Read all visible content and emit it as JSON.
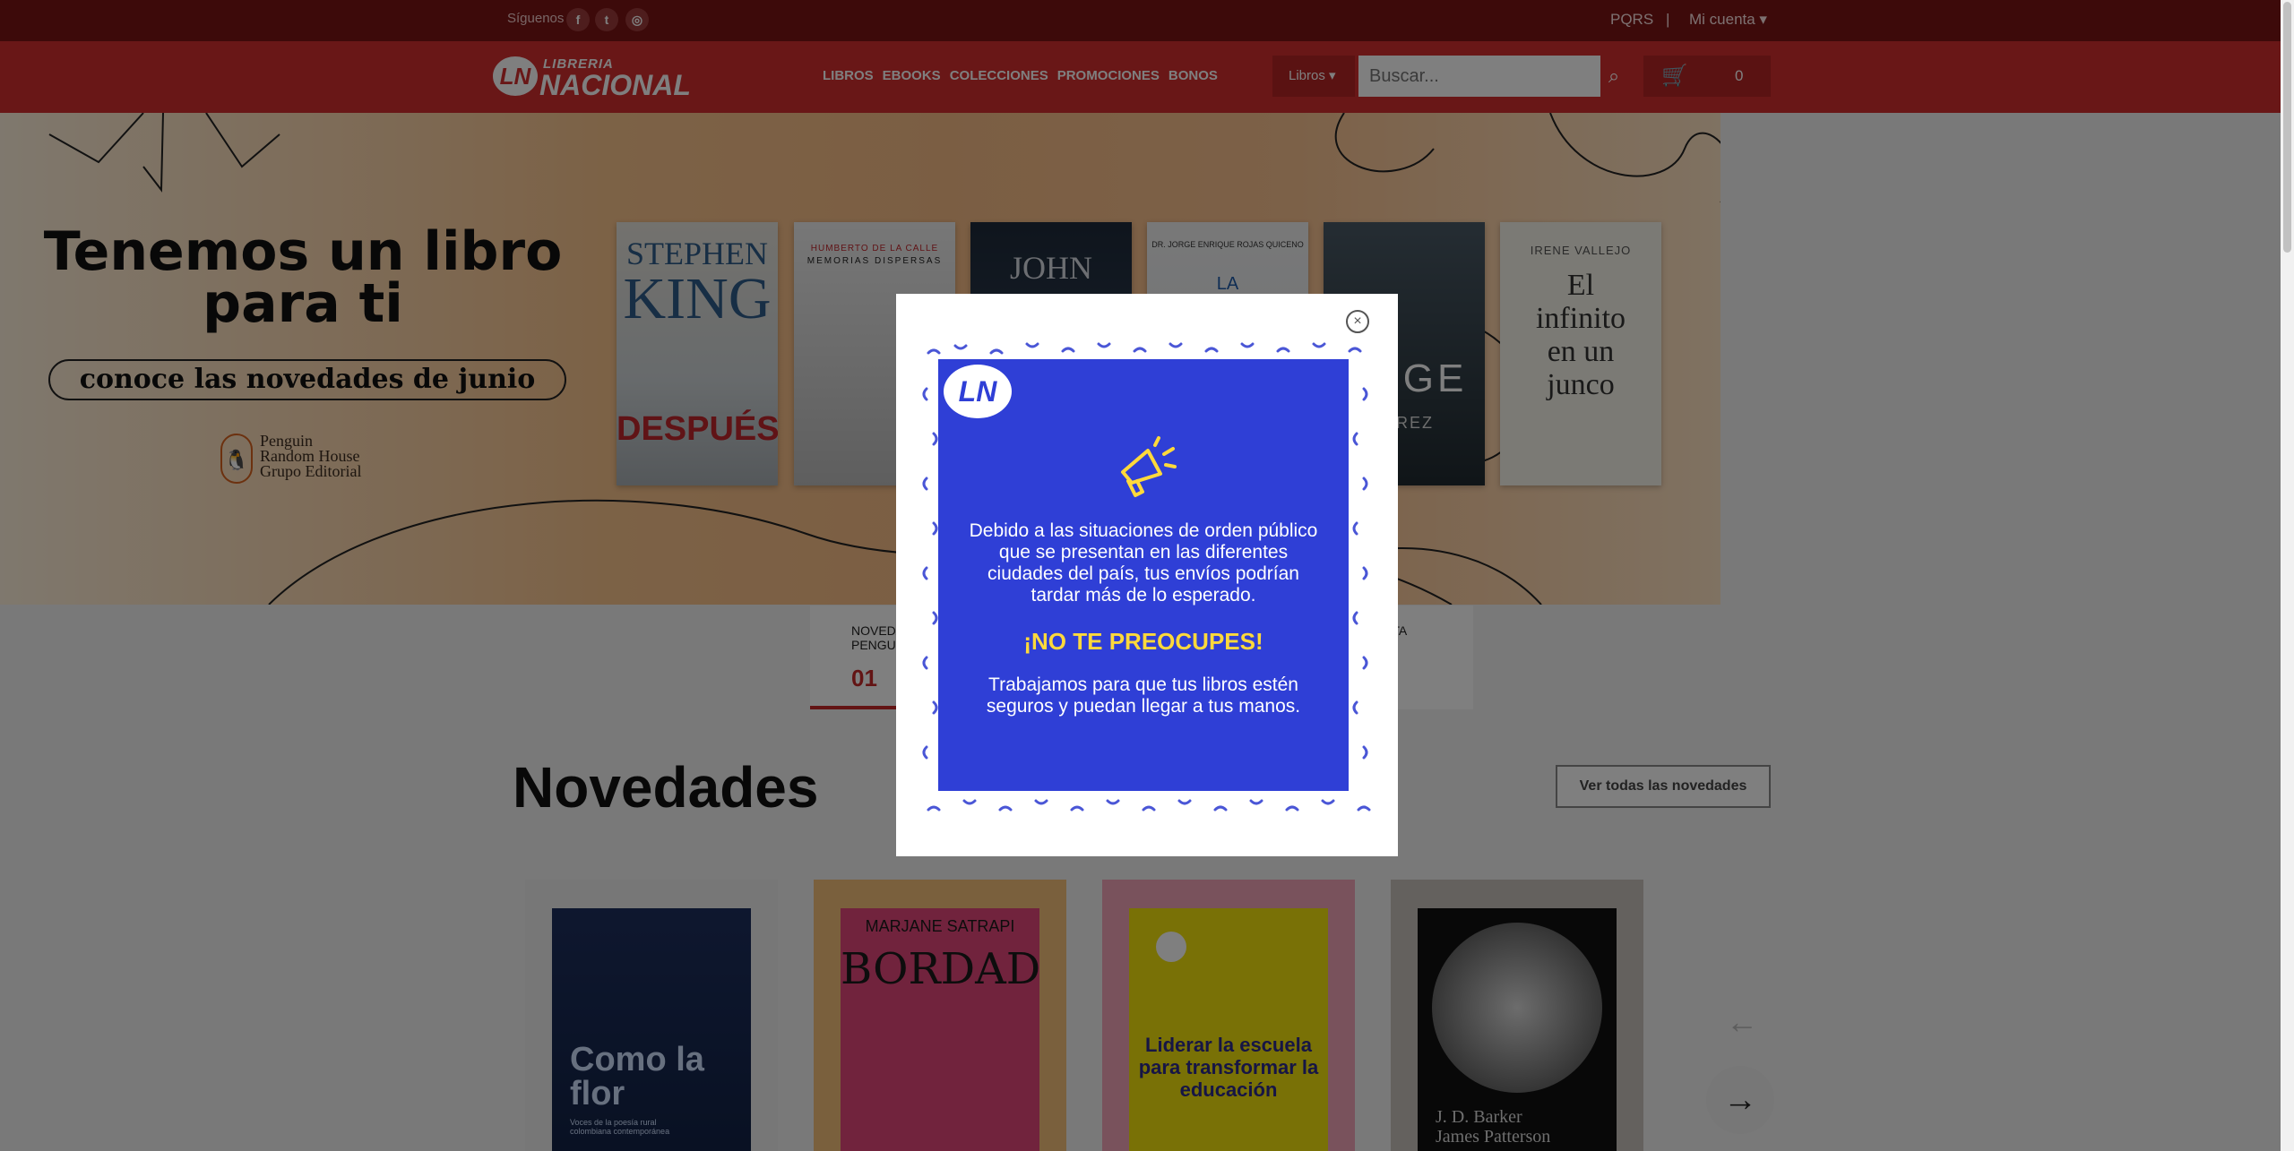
{
  "topbar": {
    "follow_label": "Síguenos",
    "social": [
      "f",
      "t",
      "◎"
    ],
    "pqrs": "PQRS",
    "separator": "|",
    "account": "Mi cuenta ▾"
  },
  "header": {
    "logo_line1": "LIBRERIA",
    "logo_line2": "NACIONAL",
    "nav": [
      "LIBROS",
      "EBOOKS",
      "COLECCIONES",
      "PROMOCIONES",
      "BONOS"
    ],
    "category_select": "Libros ▾",
    "search_placeholder": "Buscar...",
    "cart_count": "0"
  },
  "banner": {
    "headline_line1": "Tenemos un libro",
    "headline_line2": "para ti",
    "cta": "conoce las novedades de junio",
    "publisher_line1": "Penguin",
    "publisher_line2": "Random House",
    "publisher_line3": "Grupo Editorial",
    "books": [
      {
        "line1": "STEPHEN",
        "line2": "KING",
        "line3": "DESPUÉS"
      },
      {
        "line1": "HUMBERTO DE LA CALLE",
        "line2": "MEMORIAS DISPERSAS"
      },
      {
        "line1": "JOHN"
      },
      {
        "line1": "DR. JORGE ENRIQUE ROJAS QUICENO",
        "line2": "LA"
      },
      {
        "line1": "ANGE",
        "line2": "MIREZ"
      },
      {
        "line1": "IRENE VALLEJO",
        "line2": "El infinito en un junco"
      }
    ]
  },
  "tabs": {
    "tab1_label": "NOVEDADES PENGUIN RANDOM HOUSE",
    "tab1_number": "01",
    "tab3_label": "ETA"
  },
  "novedades": {
    "title": "Novedades",
    "see_all": "Ver todas las novedades",
    "books": [
      {
        "title": "Como la flor",
        "subtitle": "Voces de la poesía rural colombiana contemporánea"
      },
      {
        "title": "BORDADOS",
        "author": "MARJANE SATRAPI"
      },
      {
        "title": "Liderar la escuela para transformar la educación"
      },
      {
        "author1": "J. D. Barker",
        "author2": "James Patterson"
      }
    ]
  },
  "modal": {
    "close": "×",
    "message": "Debido a las situaciones de orden público que se presentan en las diferentes ciudades del país, tus envíos podrían tardar más de lo esperado.",
    "highlight": "¡NO TE PREOCUPES!",
    "sub": "Trabajamos para que tus libros estén seguros y puedan llegar a tus manos."
  },
  "colors": {
    "brand_red": "#d32f2f",
    "notice_blue": "#2f3fd6",
    "notice_yellow": "#ffd93b"
  }
}
